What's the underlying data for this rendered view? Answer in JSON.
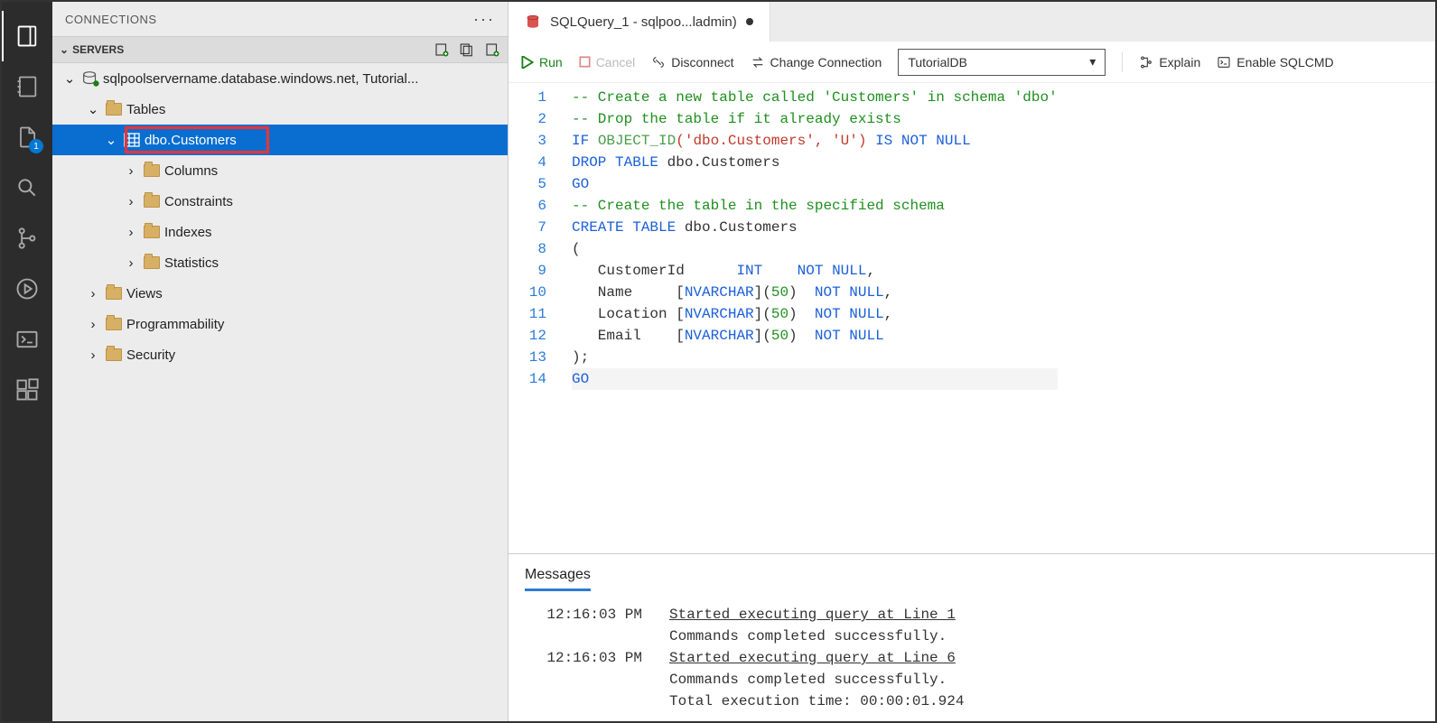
{
  "panel": {
    "title": "CONNECTIONS",
    "section": "SERVERS"
  },
  "badge": "1",
  "tree": {
    "server": "sqlpoolservername.database.windows.net, Tutorial...",
    "tables": "Tables",
    "dboCustomers": "dbo.Customers",
    "columns": "Columns",
    "constraints": "Constraints",
    "indexes": "Indexes",
    "statistics": "Statistics",
    "views": "Views",
    "programmability": "Programmability",
    "security": "Security"
  },
  "tab": {
    "label": "SQLQuery_1 - sqlpoo...ladmin)"
  },
  "toolbar": {
    "run": "Run",
    "cancel": "Cancel",
    "disconnect": "Disconnect",
    "changeConn": "Change Connection",
    "dbSelected": "TutorialDB",
    "explain": "Explain",
    "sqlcmd": "Enable SQLCMD"
  },
  "code": {
    "l1_comment": "-- Create a new table called 'Customers' in schema 'dbo'",
    "l2_comment": "-- Drop the table if it already exists",
    "l3_if": "IF",
    "l3_func": "OBJECT_ID",
    "l3_args": "('dbo.Customers', 'U')",
    "l3_tail": " IS NOT NULL",
    "l4_drop": "DROP TABLE",
    "l4_obj": " dbo.Customers",
    "l5_go": "GO",
    "l6_comment": "-- Create the table in the specified schema",
    "l7_ct": "CREATE TABLE",
    "l7_obj": " dbo.Customers",
    "l8": "(",
    "l9_col": "   CustomerId      ",
    "l9_typ": "INT",
    "l9_nn": "    NOT NULL",
    "l10_col": "   Name     [",
    "l10_typ": "NVARCHAR",
    "l10_mid": "](",
    "l10_num": "50",
    "l10_end": ")  ",
    "l10_nn": "NOT NULL",
    "l11_col": "   Location [",
    "l11_typ": "NVARCHAR",
    "l12_col": "   Email    [",
    "l13": ");",
    "l14_go": "GO"
  },
  "messages": {
    "title": "Messages",
    "r1": {
      "time": "12:16:03 PM",
      "a": "Started executing query at Line 1",
      "b": "Commands completed successfully."
    },
    "r2": {
      "time": "12:16:03 PM",
      "a": "Started executing query at Line 6",
      "b": "Commands completed successfully.",
      "c": "Total execution time: 00:00:01.924"
    }
  }
}
